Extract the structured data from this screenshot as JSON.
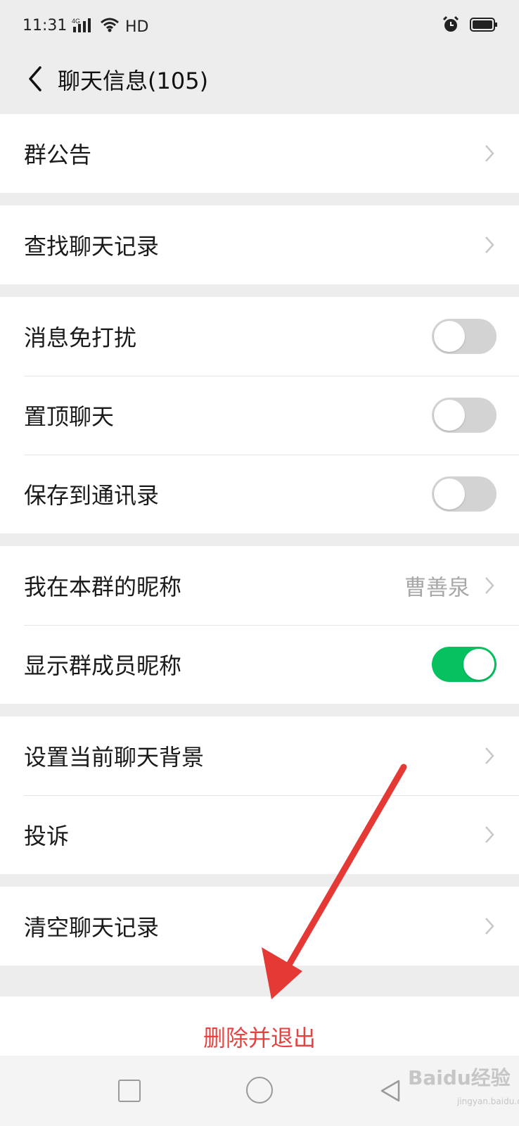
{
  "status": {
    "time": "11:31",
    "network": "4G",
    "hd": "HD"
  },
  "nav": {
    "title": "聊天信息(105)"
  },
  "groups": {
    "announcement": {
      "label": "群公告"
    },
    "search": {
      "label": "查找聊天记录"
    },
    "mute": {
      "label": "消息免打扰",
      "on": false
    },
    "pin": {
      "label": "置顶聊天",
      "on": false
    },
    "save": {
      "label": "保存到通讯录",
      "on": false
    },
    "nickname": {
      "label": "我在本群的昵称",
      "value": "曹善泉"
    },
    "show_nick": {
      "label": "显示群成员昵称",
      "on": true
    },
    "background": {
      "label": "设置当前聊天背景"
    },
    "complain": {
      "label": "投诉"
    },
    "clear": {
      "label": "清空聊天记录"
    }
  },
  "danger": {
    "label": "删除并退出"
  },
  "watermark": {
    "brand": "Baidu经验",
    "url": "jingyan.baidu.com"
  },
  "colors": {
    "accent_green": "#07c160",
    "danger_red": "#e64340",
    "annotation_red": "#e53935"
  }
}
